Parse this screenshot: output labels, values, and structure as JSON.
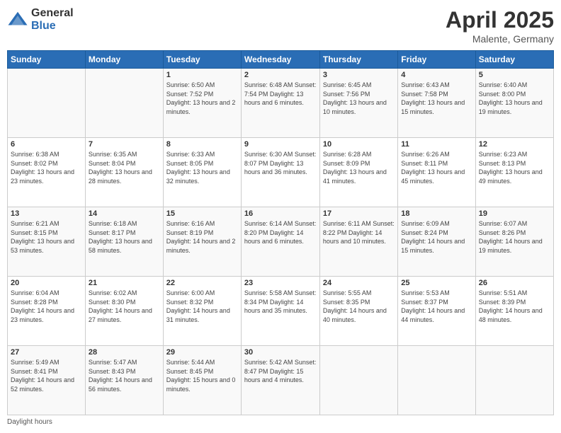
{
  "logo": {
    "general": "General",
    "blue": "Blue"
  },
  "header": {
    "month": "April 2025",
    "location": "Malente, Germany"
  },
  "days_of_week": [
    "Sunday",
    "Monday",
    "Tuesday",
    "Wednesday",
    "Thursday",
    "Friday",
    "Saturday"
  ],
  "weeks": [
    [
      {
        "day": "",
        "info": ""
      },
      {
        "day": "",
        "info": ""
      },
      {
        "day": "1",
        "info": "Sunrise: 6:50 AM\nSunset: 7:52 PM\nDaylight: 13 hours and 2 minutes."
      },
      {
        "day": "2",
        "info": "Sunrise: 6:48 AM\nSunset: 7:54 PM\nDaylight: 13 hours and 6 minutes."
      },
      {
        "day": "3",
        "info": "Sunrise: 6:45 AM\nSunset: 7:56 PM\nDaylight: 13 hours and 10 minutes."
      },
      {
        "day": "4",
        "info": "Sunrise: 6:43 AM\nSunset: 7:58 PM\nDaylight: 13 hours and 15 minutes."
      },
      {
        "day": "5",
        "info": "Sunrise: 6:40 AM\nSunset: 8:00 PM\nDaylight: 13 hours and 19 minutes."
      }
    ],
    [
      {
        "day": "6",
        "info": "Sunrise: 6:38 AM\nSunset: 8:02 PM\nDaylight: 13 hours and 23 minutes."
      },
      {
        "day": "7",
        "info": "Sunrise: 6:35 AM\nSunset: 8:04 PM\nDaylight: 13 hours and 28 minutes."
      },
      {
        "day": "8",
        "info": "Sunrise: 6:33 AM\nSunset: 8:05 PM\nDaylight: 13 hours and 32 minutes."
      },
      {
        "day": "9",
        "info": "Sunrise: 6:30 AM\nSunset: 8:07 PM\nDaylight: 13 hours and 36 minutes."
      },
      {
        "day": "10",
        "info": "Sunrise: 6:28 AM\nSunset: 8:09 PM\nDaylight: 13 hours and 41 minutes."
      },
      {
        "day": "11",
        "info": "Sunrise: 6:26 AM\nSunset: 8:11 PM\nDaylight: 13 hours and 45 minutes."
      },
      {
        "day": "12",
        "info": "Sunrise: 6:23 AM\nSunset: 8:13 PM\nDaylight: 13 hours and 49 minutes."
      }
    ],
    [
      {
        "day": "13",
        "info": "Sunrise: 6:21 AM\nSunset: 8:15 PM\nDaylight: 13 hours and 53 minutes."
      },
      {
        "day": "14",
        "info": "Sunrise: 6:18 AM\nSunset: 8:17 PM\nDaylight: 13 hours and 58 minutes."
      },
      {
        "day": "15",
        "info": "Sunrise: 6:16 AM\nSunset: 8:19 PM\nDaylight: 14 hours and 2 minutes."
      },
      {
        "day": "16",
        "info": "Sunrise: 6:14 AM\nSunset: 8:20 PM\nDaylight: 14 hours and 6 minutes."
      },
      {
        "day": "17",
        "info": "Sunrise: 6:11 AM\nSunset: 8:22 PM\nDaylight: 14 hours and 10 minutes."
      },
      {
        "day": "18",
        "info": "Sunrise: 6:09 AM\nSunset: 8:24 PM\nDaylight: 14 hours and 15 minutes."
      },
      {
        "day": "19",
        "info": "Sunrise: 6:07 AM\nSunset: 8:26 PM\nDaylight: 14 hours and 19 minutes."
      }
    ],
    [
      {
        "day": "20",
        "info": "Sunrise: 6:04 AM\nSunset: 8:28 PM\nDaylight: 14 hours and 23 minutes."
      },
      {
        "day": "21",
        "info": "Sunrise: 6:02 AM\nSunset: 8:30 PM\nDaylight: 14 hours and 27 minutes."
      },
      {
        "day": "22",
        "info": "Sunrise: 6:00 AM\nSunset: 8:32 PM\nDaylight: 14 hours and 31 minutes."
      },
      {
        "day": "23",
        "info": "Sunrise: 5:58 AM\nSunset: 8:34 PM\nDaylight: 14 hours and 35 minutes."
      },
      {
        "day": "24",
        "info": "Sunrise: 5:55 AM\nSunset: 8:35 PM\nDaylight: 14 hours and 40 minutes."
      },
      {
        "day": "25",
        "info": "Sunrise: 5:53 AM\nSunset: 8:37 PM\nDaylight: 14 hours and 44 minutes."
      },
      {
        "day": "26",
        "info": "Sunrise: 5:51 AM\nSunset: 8:39 PM\nDaylight: 14 hours and 48 minutes."
      }
    ],
    [
      {
        "day": "27",
        "info": "Sunrise: 5:49 AM\nSunset: 8:41 PM\nDaylight: 14 hours and 52 minutes."
      },
      {
        "day": "28",
        "info": "Sunrise: 5:47 AM\nSunset: 8:43 PM\nDaylight: 14 hours and 56 minutes."
      },
      {
        "day": "29",
        "info": "Sunrise: 5:44 AM\nSunset: 8:45 PM\nDaylight: 15 hours and 0 minutes."
      },
      {
        "day": "30",
        "info": "Sunrise: 5:42 AM\nSunset: 8:47 PM\nDaylight: 15 hours and 4 minutes."
      },
      {
        "day": "",
        "info": ""
      },
      {
        "day": "",
        "info": ""
      },
      {
        "day": "",
        "info": ""
      }
    ]
  ],
  "footer": {
    "daylight_label": "Daylight hours"
  }
}
